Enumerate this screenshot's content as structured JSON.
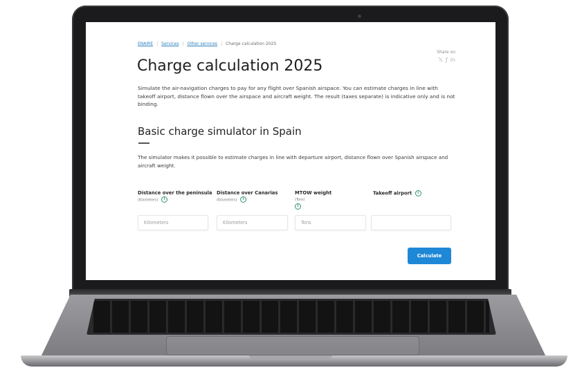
{
  "breadcrumb": {
    "items": [
      "ENAIRE",
      "Services",
      "Other services"
    ],
    "current": "Charge calculation 2025"
  },
  "share": {
    "label": "Share on",
    "icons": [
      "x-icon",
      "facebook-icon",
      "linkedin-icon"
    ]
  },
  "page": {
    "title": "Charge calculation 2025",
    "intro": "Simulate the air-navigation charges to pay for any flight over Spanish airspace. You can estimate charges in line with takeoff airport, distance flown over the airspace and aircraft weight. The result (taxes separate) is indicative only and is not binding."
  },
  "simulator": {
    "title": "Basic charge simulator in Spain",
    "description": "The simulator makes it possible to estimate charges in line with departure airport, distance flown over Spanish airspace and aircraft weight.",
    "fields": [
      {
        "label": "Distance over the peninsula",
        "sub": "(Kilometers)",
        "placeholder": "Kilometers"
      },
      {
        "label": "Distance over Canarias",
        "sub": "(Kilometers)",
        "placeholder": "Kilometers"
      },
      {
        "label": "MTOW weight",
        "sub": "(Tons)",
        "placeholder": "Tons"
      },
      {
        "label": "Takeoff airport",
        "sub": "",
        "placeholder": ""
      }
    ],
    "button_label": "Calculate"
  },
  "colors": {
    "accent": "#1e88d6",
    "info_icon": "#2f8f74",
    "link": "#2a7fbe"
  }
}
